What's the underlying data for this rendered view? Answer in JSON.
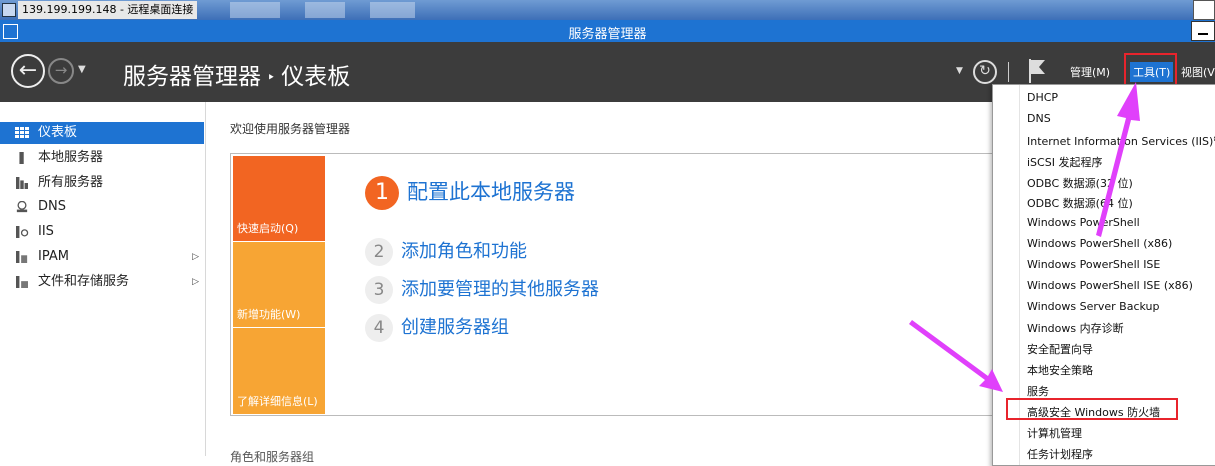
{
  "rdp": {
    "title": "139.199.199.148 - 远程桌面连接"
  },
  "window": {
    "title": "服务器管理器"
  },
  "header": {
    "breadcrumb_root": "服务器管理器",
    "breadcrumb_sep": "‣",
    "breadcrumb_page": "仪表板",
    "menu": {
      "manage": "管理(M)",
      "tools": "工具(T)",
      "view": "视图(V"
    }
  },
  "sidebar": {
    "items": [
      {
        "label": "仪表板",
        "icon": "dashboard-icon",
        "active": true
      },
      {
        "label": "本地服务器",
        "icon": "server-icon"
      },
      {
        "label": "所有服务器",
        "icon": "servers-icon"
      },
      {
        "label": "DNS",
        "icon": "dns-icon"
      },
      {
        "label": "IIS",
        "icon": "iis-icon"
      },
      {
        "label": "IPAM",
        "icon": "ipam-icon",
        "expandable": true
      },
      {
        "label": "文件和存储服务",
        "icon": "file-storage-icon",
        "expandable": true
      }
    ]
  },
  "main": {
    "welcome": "欢迎使用服务器管理器",
    "tiles": [
      "快速启动(Q)",
      "新增功能(W)",
      "了解详细信息(L)"
    ],
    "steps": [
      {
        "num": "1",
        "label": "配置此本地服务器"
      },
      {
        "num": "2",
        "label": "添加角色和功能"
      },
      {
        "num": "3",
        "label": "添加要管理的其他服务器"
      },
      {
        "num": "4",
        "label": "创建服务器组"
      }
    ],
    "roles_header": "角色和服务器组"
  },
  "tools_menu": {
    "items": [
      "DHCP",
      "DNS",
      "Internet Information Services (IIS)管",
      "iSCSI 发起程序",
      "ODBC 数据源(32 位)",
      "ODBC 数据源(64 位)",
      "Windows PowerShell",
      "Windows PowerShell (x86)",
      "Windows PowerShell ISE",
      "Windows PowerShell ISE (x86)",
      "Windows Server Backup",
      "Windows 内存诊断",
      "安全配置向导",
      "本地安全策略",
      "服务",
      "高级安全 Windows 防火墙",
      "计算机管理",
      "任务计划程序"
    ]
  },
  "colors": {
    "accent": "#1e73d2",
    "orange": "#f26522",
    "amber": "#f7a534",
    "highlight": "#e8242c",
    "arrow": "#e040fb"
  }
}
